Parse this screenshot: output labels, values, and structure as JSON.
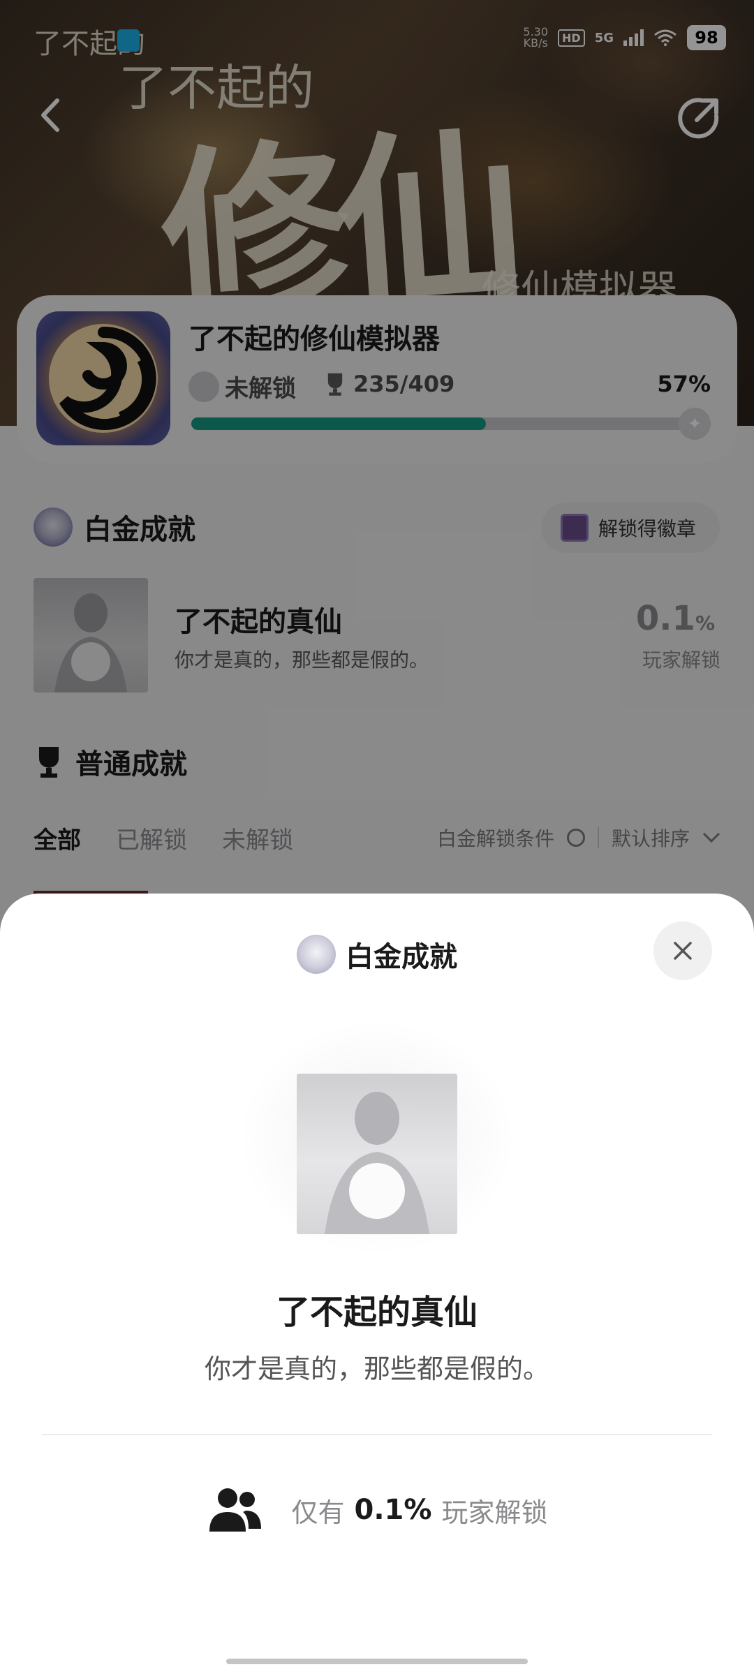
{
  "status_bar": {
    "net_speed": "5.30",
    "net_unit": "KB/s",
    "hd": "HD",
    "network": "5G",
    "battery": "98"
  },
  "hero": {
    "title_art": "修仙",
    "title_small": "了不起的",
    "logo_text": "了不起的",
    "sub_art": "修仙模拟器"
  },
  "game": {
    "title": "了不起的修仙模拟器",
    "lock_status": "未解锁",
    "trophy_count": "235/409",
    "progress_percent": "57%",
    "progress_fraction": 0.57
  },
  "platinum_section": {
    "title": "白金成就",
    "badge_button": "解锁得徽章",
    "achievement": {
      "name": "了不起的真仙",
      "description": "你才是真的，那些都是假的。",
      "rate_value": "0.1",
      "rate_unit": "%",
      "rate_label": "玩家解锁"
    }
  },
  "normal_section": {
    "title": "普通成就",
    "tabs": [
      "全部",
      "已解锁",
      "未解锁"
    ],
    "filter_condition": "白金解锁条件",
    "sort_label": "默认排序"
  },
  "sheet": {
    "title": "白金成就",
    "name": "了不起的真仙",
    "description": "你才是真的，那些都是假的。",
    "stat_prefix": "仅有",
    "stat_value": "0.1%",
    "stat_suffix": "玩家解锁"
  },
  "colors": {
    "accent": "#159983",
    "overlay": "rgba(0,0,0,0.42)"
  },
  "icons": [
    "back-icon",
    "share-icon",
    "wifi-icon",
    "trophy-icon",
    "platinum-icon",
    "close-icon",
    "people-icon",
    "chevron-down-icon"
  ]
}
